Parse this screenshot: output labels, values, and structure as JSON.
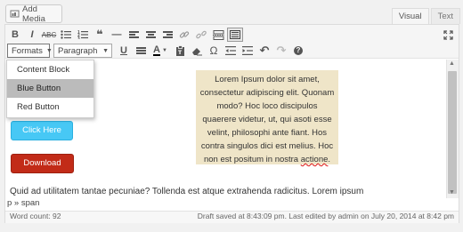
{
  "add_media": {
    "label": "Add Media",
    "icon": "media-icon"
  },
  "tabs": [
    {
      "label": "Visual",
      "active": true
    },
    {
      "label": "Text",
      "active": false
    }
  ],
  "toolbar": {
    "row1": [
      {
        "name": "bold-button",
        "glyph": "B"
      },
      {
        "name": "italic-button",
        "glyph": "I"
      },
      {
        "name": "strikethrough-button",
        "glyph": "ABC"
      },
      {
        "name": "bullet-list-button",
        "glyph": "•≡"
      },
      {
        "name": "numbered-list-button",
        "glyph": "1≡"
      },
      {
        "name": "blockquote-button",
        "glyph": "❝"
      },
      {
        "name": "horizontal-line-button",
        "glyph": "—"
      },
      {
        "name": "align-left-button",
        "glyph": "≡"
      },
      {
        "name": "align-center-button",
        "glyph": "≡"
      },
      {
        "name": "align-right-button",
        "glyph": "≡"
      },
      {
        "name": "insert-link-button",
        "glyph": "🔗"
      },
      {
        "name": "unlink-button",
        "glyph": "⛓"
      },
      {
        "name": "read-more-button",
        "glyph": "▭"
      },
      {
        "name": "toolbar-toggle-button",
        "glyph": "▦"
      },
      {
        "name": "fullscreen-button",
        "glyph": "⤢"
      }
    ],
    "formats_label": "Formats",
    "paragraph_label": "Paragraph",
    "row2": [
      {
        "name": "underline-button",
        "glyph": "U"
      },
      {
        "name": "justify-button",
        "glyph": "≡"
      },
      {
        "name": "text-color-button",
        "glyph": "A"
      },
      {
        "name": "paste-as-text-button",
        "glyph": "📋"
      },
      {
        "name": "clear-formatting-button",
        "glyph": "⌫"
      },
      {
        "name": "special-character-button",
        "glyph": "Ω"
      },
      {
        "name": "outdent-button",
        "glyph": "⇤"
      },
      {
        "name": "indent-button",
        "glyph": "⇥"
      },
      {
        "name": "undo-button",
        "glyph": "↶"
      },
      {
        "name": "redo-button",
        "glyph": "↷"
      },
      {
        "name": "help-button",
        "glyph": "?"
      }
    ]
  },
  "formats_menu": [
    "Content Block",
    "Blue Button",
    "Red Button"
  ],
  "formats_menu_highlighted": "Blue Button",
  "buttons": {
    "blue": "Click Here",
    "red": "Download"
  },
  "content_block": {
    "text_before": "Lorem Ipsum dolor sit amet, consectetur adipiscing elit. Quonam modo? Hoc loco discipulos quaerere videtur, ut, qui asoti esse velint, philosophi ante fiant. Hos contra singulos dici est melius. Hoc non est positum in nostra ",
    "text_spell": "actione",
    "text_after": "."
  },
  "paragraph_text": "Quid ad utilitatem tantae pecuniae? Tollenda est atque extrahenda radicitus. Lorem ipsum",
  "path": "p » span",
  "word_count": "Word count: 92",
  "save_status": "Draft saved at 8:43:09 pm. Last edited by admin on July 20, 2014 at 8:42 pm",
  "colors": {
    "blue_button": "#47c8f5",
    "red_button": "#c22b18",
    "content_block_bg": "#efe5c8",
    "menu_highlight": "#bbbbbb"
  }
}
